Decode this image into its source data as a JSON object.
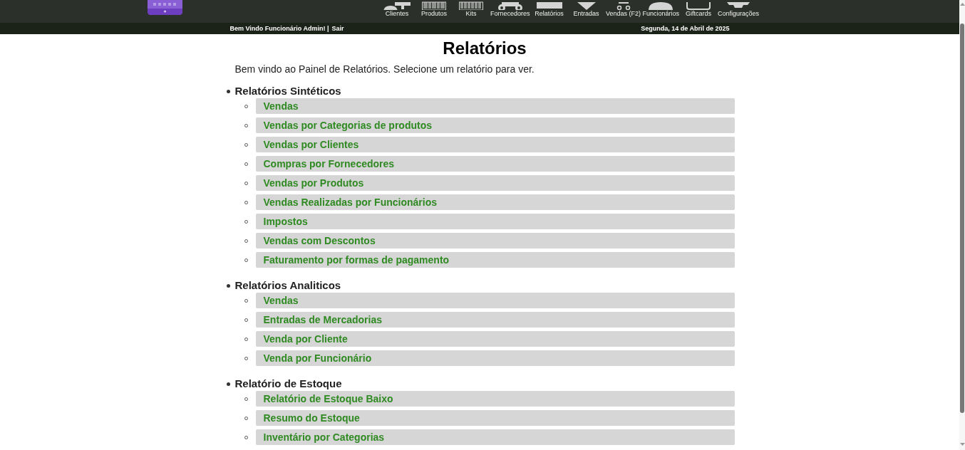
{
  "header": {
    "nav_items": [
      {
        "label": "Clientes"
      },
      {
        "label": "Produtos"
      },
      {
        "label": "Kits"
      },
      {
        "label": "Fornecedores"
      },
      {
        "label": "Relatórios"
      },
      {
        "label": "Entradas"
      },
      {
        "label": "Vendas (F2)"
      },
      {
        "label": "Funcionários"
      },
      {
        "label": "Giftcards"
      },
      {
        "label": "Configurações"
      }
    ]
  },
  "user_bar": {
    "greeting": "Bem Vindo Funcionário Admin! |",
    "logout": "Sair",
    "date": "Segunda, 14 de Abril de 2025"
  },
  "page": {
    "title": "Relatórios",
    "intro": "Bem vindo ao Painel de Relatórios. Selecione um relatório para ver.",
    "sections": [
      {
        "title": "Relatórios Sintéticos",
        "reports": [
          "Vendas",
          "Vendas por Categorias de produtos",
          "Vendas por Clientes",
          "Compras por Fornecedores",
          "Vendas por Produtos",
          "Vendas Realizadas por Funcionários",
          "Impostos",
          "Vendas com Descontos",
          "Faturamento por formas de pagamento"
        ]
      },
      {
        "title": "Relatórios Analiticos",
        "reports": [
          "Vendas",
          "Entradas de Mercadorias",
          "Venda por Cliente",
          "Venda por Funcionário"
        ]
      },
      {
        "title": "Relatório de Estoque",
        "reports": [
          "Relatório de Estoque Baixo",
          "Resumo do Estoque",
          "Inventário por Categorias"
        ]
      }
    ]
  }
}
